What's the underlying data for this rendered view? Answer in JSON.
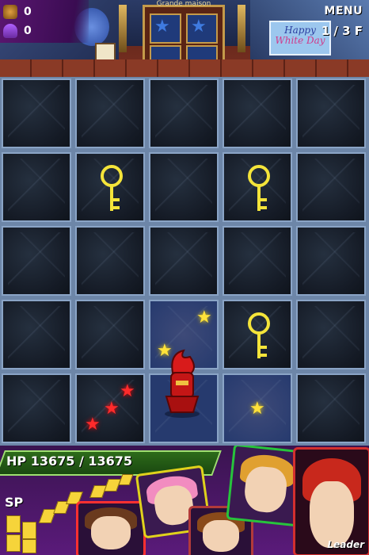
{
  "hud": {
    "resource1_value": "0",
    "resource2_value": "0",
    "menu_label": "MENU",
    "floor_label": "1 / 3 F"
  },
  "scene": {
    "shop_sign": "Grande maison",
    "poster_line1": "Happy",
    "poster_line2": "White Day"
  },
  "grid": {
    "rows": 5,
    "cols": 5,
    "tiles": [
      [
        "dark",
        "dark",
        "dark",
        "dark",
        "dark"
      ],
      [
        "dark",
        "key",
        "dark",
        "key",
        "dark"
      ],
      [
        "dark",
        "dark",
        "dark",
        "dark",
        "dark"
      ],
      [
        "dark",
        "dark",
        "stars",
        "key",
        "dark"
      ],
      [
        "dark",
        "red-stars",
        "player",
        "star",
        "dark"
      ]
    ]
  },
  "player_status": {
    "hp_label": "HP",
    "hp_value": "13675 / 13675",
    "sp_label": "SP"
  },
  "party": {
    "leader_label": "Leader",
    "frame_colors": [
      "#e0d21c",
      "#ff3030",
      "#27c43c",
      "#d32f2f",
      "#b23a3a"
    ]
  },
  "colors": {
    "key": "#f4e43a",
    "star_yellow": "#ffe23a",
    "star_red": "#ff2b2b",
    "hp_green": "#2d6b1a",
    "sp_yellow": "#f6d43a"
  }
}
